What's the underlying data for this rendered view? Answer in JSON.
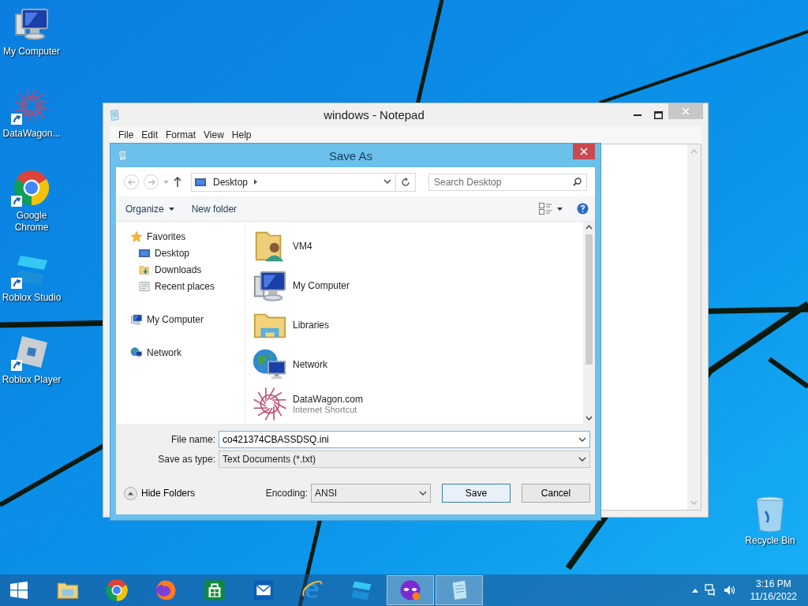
{
  "desktop_icons": [
    {
      "label": "My Computer",
      "kind": "computer",
      "shortcut": false
    },
    {
      "label": "DataWagon...",
      "kind": "starburst",
      "shortcut": true
    },
    {
      "label": "Google Chrome",
      "kind": "ring",
      "shortcut": true
    },
    {
      "label": "Roblox Studio",
      "kind": "tiles",
      "shortcut": true
    },
    {
      "label": "Roblox Player",
      "kind": "tilted-square",
      "shortcut": true
    }
  ],
  "recycle_bin": {
    "label": "Recycle Bin"
  },
  "notepad": {
    "title": "windows - Notepad",
    "menu": [
      "File",
      "Edit",
      "Format",
      "View",
      "Help"
    ]
  },
  "save_dialog": {
    "title": "Save As",
    "address": "Desktop",
    "search_placeholder": "Search Desktop",
    "organize": "Organize",
    "new_folder": "New folder",
    "nav": [
      {
        "label": "Favorites",
        "kind": "star",
        "children": [
          {
            "label": "Desktop",
            "kind": "desktop"
          },
          {
            "label": "Downloads",
            "kind": "downloads"
          },
          {
            "label": "Recent places",
            "kind": "recent"
          }
        ]
      },
      {
        "label": "My Computer",
        "kind": "computer-small"
      },
      {
        "label": "Network",
        "kind": "network-small"
      }
    ],
    "files": [
      {
        "name": "VM4",
        "kind": "user-folder"
      },
      {
        "name": "My Computer",
        "kind": "computer"
      },
      {
        "name": "Libraries",
        "kind": "libraries"
      },
      {
        "name": "Network",
        "kind": "network"
      },
      {
        "name": "DataWagon.com",
        "subtitle": "Internet Shortcut",
        "kind": "starburst"
      }
    ],
    "file_name_label": "File name:",
    "file_name": "co421374CBASSDSQ.ini",
    "type_label": "Save as type:",
    "type": "Text Documents (*.txt)",
    "hide_folders": "Hide Folders",
    "encoding_label": "Encoding:",
    "encoding": "ANSI",
    "buttons": [
      "Save",
      "Cancel"
    ]
  },
  "taskbar": {
    "apps": [
      {
        "kind": "folder",
        "running": false
      },
      {
        "kind": "ring",
        "running": false
      },
      {
        "kind": "fox",
        "running": false
      },
      {
        "kind": "bag",
        "running": false
      },
      {
        "kind": "envelope",
        "running": false
      },
      {
        "kind": "letter-e",
        "running": false
      },
      {
        "kind": "tiles",
        "running": false
      },
      {
        "kind": "mask",
        "running": true
      },
      {
        "kind": "notepad",
        "running": true
      }
    ],
    "time": "3:16 PM",
    "date": "11/16/2022"
  }
}
